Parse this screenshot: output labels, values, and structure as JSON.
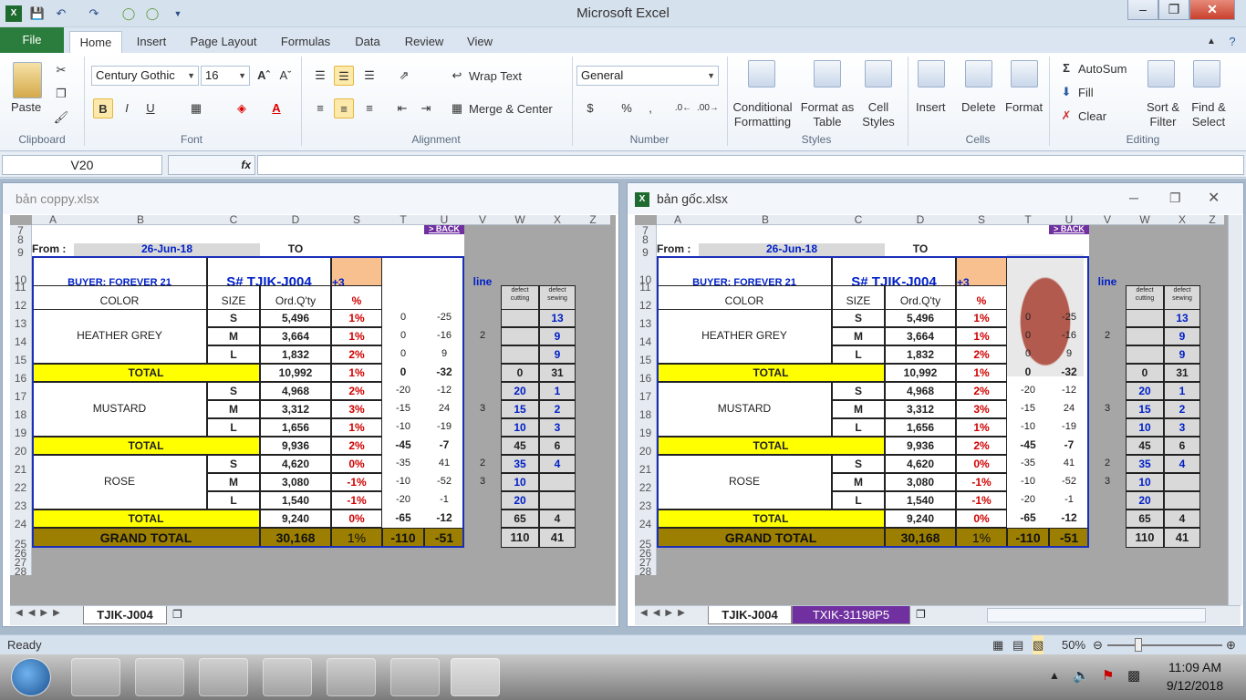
{
  "app": {
    "title": "Microsoft Excel",
    "tabs": [
      "File",
      "Home",
      "Insert",
      "Page Layout",
      "Formulas",
      "Data",
      "Review",
      "View"
    ]
  },
  "ribbon": {
    "clipboard": {
      "label": "Clipboard",
      "paste": "Paste"
    },
    "font": {
      "label": "Font",
      "name": "Century Gothic",
      "size": "16",
      "bold": "B",
      "italic": "I",
      "underline": "U"
    },
    "alignment": {
      "label": "Alignment",
      "wrap": "Wrap Text",
      "merge": "Merge & Center"
    },
    "number": {
      "label": "Number",
      "format": "General",
      "currency": "$",
      "percent": "%",
      "comma": ","
    },
    "styles": {
      "label": "Styles",
      "conditional": "Conditional Formatting",
      "format_table": "Format as Table",
      "cell_styles": "Cell Styles"
    },
    "cells": {
      "label": "Cells",
      "insert": "Insert",
      "delete": "Delete",
      "format": "Format"
    },
    "editing": {
      "label": "Editing",
      "autosum": "AutoSum",
      "fill": "Fill",
      "clear": "Clear",
      "sort": "Sort & Filter",
      "find": "Find & Select"
    }
  },
  "formula": {
    "namebox": "V20",
    "fx": "fx",
    "value": ""
  },
  "workbooks": [
    {
      "title": "bản coppy.xlsx",
      "tabs": [
        "TJIK-J004"
      ]
    },
    {
      "title": "bản gốc.xlsx",
      "tabs": [
        "TJIK-J004",
        "TXIK-31198P5"
      ]
    }
  ],
  "sheet": {
    "cols": [
      "A",
      "B",
      "C",
      "D",
      "S",
      "T",
      "U",
      "V",
      "W",
      "X",
      "Z"
    ],
    "rows": [
      "7",
      "8",
      "9",
      "10",
      "11",
      "12",
      "13",
      "14",
      "15",
      "16",
      "17",
      "18",
      "19",
      "20",
      "21",
      "22",
      "23",
      "24",
      "25",
      "26",
      "27",
      "28"
    ],
    "back": "> BACK",
    "from_label": "From :",
    "from_date": "26-Jun-18",
    "to_label": "TO",
    "buyer": "BUYER: FOREVER 21",
    "style_no": "S# TJIK-J004",
    "plus3": "+3",
    "line": "line",
    "h_color": "COLOR",
    "h_size": "SIZE",
    "h_ord": "Ord.Q'ty",
    "h_pct": "%",
    "h_dc": "defect cutting",
    "h_ds": "defect sewing",
    "groups": [
      {
        "color": "HEATHER GREY",
        "rows": [
          [
            "S",
            "5,496",
            "1%",
            "0",
            "-25",
            "",
            "",
            "13"
          ],
          [
            "M",
            "3,664",
            "1%",
            "0",
            "-16",
            "2",
            "",
            "9"
          ],
          [
            "L",
            "1,832",
            "2%",
            "0",
            "9",
            "",
            "",
            "9"
          ]
        ],
        "total": [
          "TOTAL",
          "10,992",
          "1%",
          "0",
          "-32",
          "",
          "0",
          "31"
        ]
      },
      {
        "color": "MUSTARD",
        "rows": [
          [
            "S",
            "4,968",
            "2%",
            "-20",
            "-12",
            "",
            "20",
            "1"
          ],
          [
            "M",
            "3,312",
            "3%",
            "-15",
            "24",
            "3",
            "15",
            "2"
          ],
          [
            "L",
            "1,656",
            "1%",
            "-10",
            "-19",
            "",
            "10",
            "3"
          ]
        ],
        "total": [
          "TOTAL",
          "9,936",
          "2%",
          "-45",
          "-7",
          "",
          "45",
          "6"
        ]
      },
      {
        "color": "ROSE",
        "rows": [
          [
            "S",
            "4,620",
            "0%",
            "-35",
            "41",
            "2",
            "35",
            "4"
          ],
          [
            "M",
            "3,080",
            "-1%",
            "-10",
            "-52",
            "3",
            "10",
            ""
          ],
          [
            "L",
            "1,540",
            "-1%",
            "-20",
            "-1",
            "",
            "20",
            ""
          ]
        ],
        "total": [
          "TOTAL",
          "9,240",
          "0%",
          "-65",
          "-12",
          "",
          "65",
          "4"
        ]
      }
    ],
    "grand": [
      "GRAND TOTAL",
      "30,168",
      "1%",
      "-110",
      "-51",
      "110",
      "41"
    ]
  },
  "status": {
    "ready": "Ready",
    "zoom": "50%"
  },
  "taskbar": {
    "time": "11:09 AM",
    "date": "9/12/2018"
  }
}
